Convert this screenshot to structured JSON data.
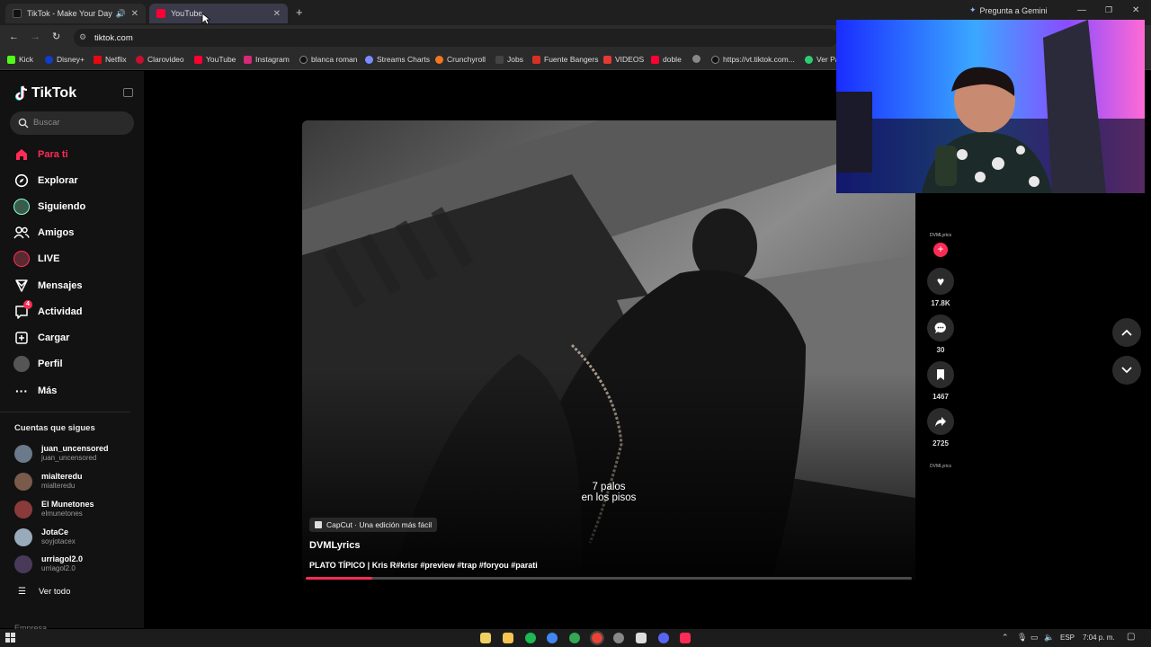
{
  "browser": {
    "tabs": [
      {
        "title": "TikTok - Make Your Day",
        "active": true
      },
      {
        "title": "YouTube",
        "active": false
      }
    ],
    "gemini_label": "Pregunta a Gemini",
    "url": "tiktok.com",
    "bookmarks": [
      "Kick",
      "Disney+",
      "Netflix",
      "Clarovideo",
      "YouTube",
      "Instagram",
      "blanca roman",
      "Streams Charts",
      "Crunchyroll",
      "Jobs",
      "Fuente Bangers",
      "VIDEOS",
      "doble",
      "https://vt.tiktok.com...",
      "Ver Pa"
    ]
  },
  "sidebar": {
    "logo": "TikTok",
    "search_placeholder": "Buscar",
    "nav": [
      {
        "label": "Para ti",
        "icon": "home-icon"
      },
      {
        "label": "Explorar",
        "icon": "compass-icon"
      },
      {
        "label": "Siguiendo",
        "icon": "following-icon"
      },
      {
        "label": "Amigos",
        "icon": "friends-icon"
      },
      {
        "label": "LIVE",
        "icon": "live-icon"
      },
      {
        "label": "Mensajes",
        "icon": "messages-icon"
      },
      {
        "label": "Actividad",
        "icon": "activity-icon",
        "badge": "4"
      },
      {
        "label": "Cargar",
        "icon": "upload-icon"
      },
      {
        "label": "Perfil",
        "icon": "profile-icon"
      },
      {
        "label": "Más",
        "icon": "more-icon"
      }
    ],
    "following_title": "Cuentas que sigues",
    "accounts": [
      {
        "name": "juan_uncensored",
        "handle": "juan_uncensored"
      },
      {
        "name": "mialteredu",
        "handle": "mialteredu"
      },
      {
        "name": "El Munetones",
        "handle": "elmunetones"
      },
      {
        "name": "JotaCe",
        "handle": "soyjotacex"
      },
      {
        "name": "urriagol2.0",
        "handle": "urriagol2.0"
      }
    ],
    "see_all": "Ver todo",
    "footer_partial": "Empresa"
  },
  "video": {
    "caption_line1": "7 palos",
    "caption_line2": "en los pisos",
    "capcut_label": "CapCut · Una edición más fácil",
    "author": "DVMLyrics",
    "description": "PLATO TÍPICO | Kris R#krisr #preview #trap #foryou #parati",
    "progress": 0.11
  },
  "rail": {
    "avatar_text": "DVMLyrics",
    "likes": "17.8K",
    "comments": "30",
    "saves": "1467",
    "shares": "2725",
    "sound_text": "DVMLyrics"
  },
  "taskbar": {
    "lang": "ESP",
    "time": "7:04 p. m."
  },
  "colors": {
    "brand": "#fe2c55",
    "bg": "#121212"
  }
}
